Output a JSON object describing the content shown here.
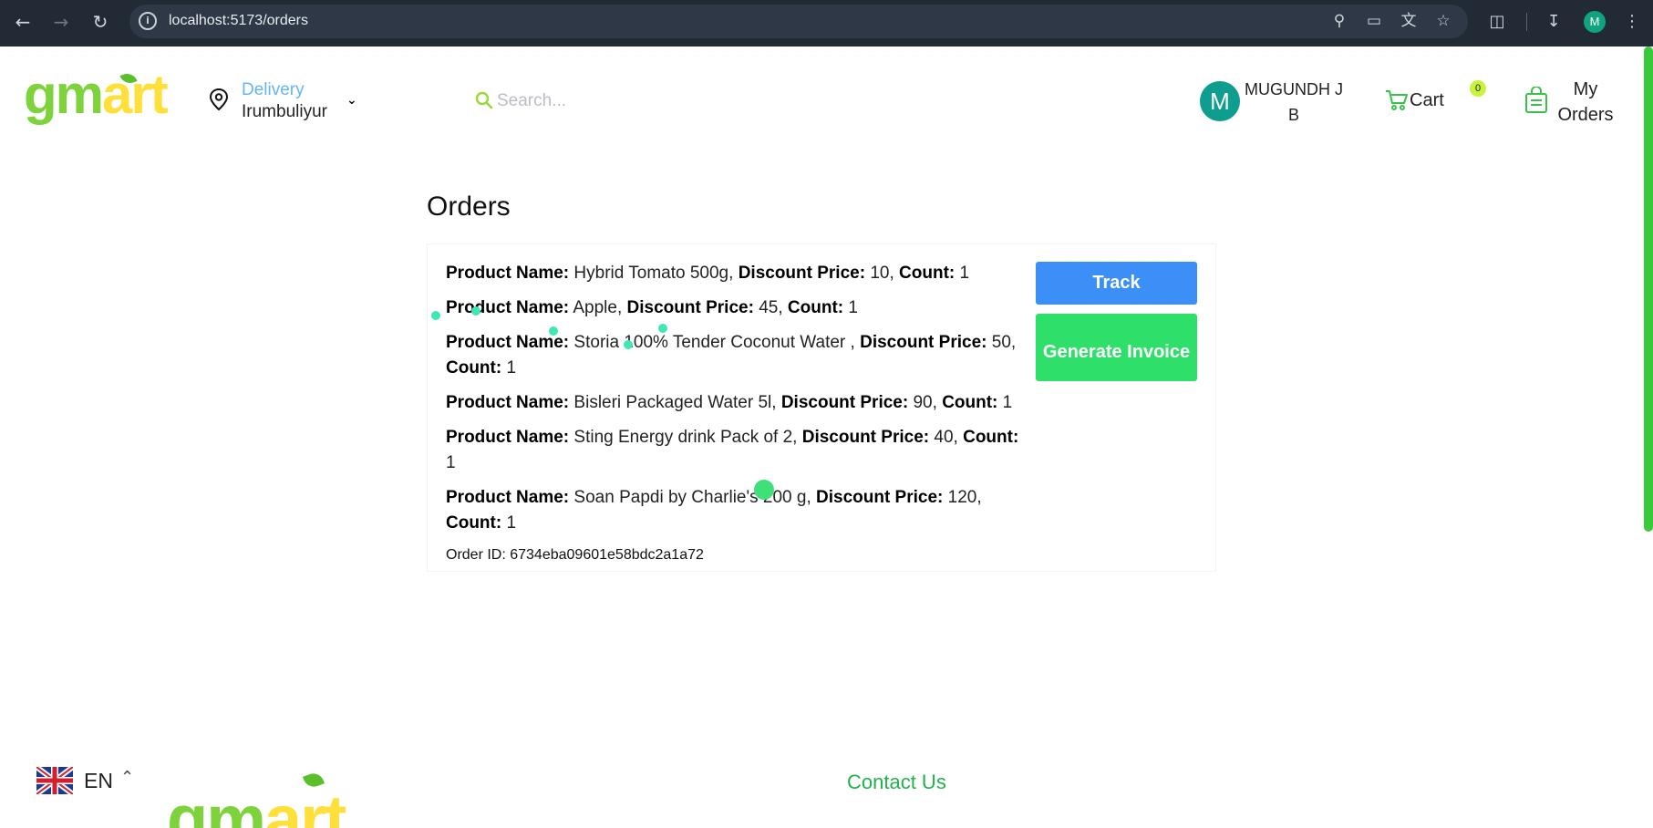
{
  "browser": {
    "url": "localhost:5173/orders",
    "profile_initial": "M"
  },
  "header": {
    "logo": {
      "g": "g",
      "m": "m",
      "a": "a",
      "rt": "rt"
    },
    "delivery_label": "Delivery",
    "city": "Irumbuliyur",
    "search_placeholder": "Search...",
    "user_initial": "M",
    "user_name": "MUGUNDH J B",
    "cart_label": "Cart",
    "cart_count": "0",
    "orders_label": "My Orders"
  },
  "main": {
    "title": "Orders",
    "labels": {
      "product_name": "Product Name:",
      "discount_price": "Discount Price:",
      "count": "Count:"
    },
    "order": {
      "items": [
        {
          "name": "Hybrid Tomato 500g",
          "price": "10",
          "count": "1"
        },
        {
          "name": "Apple",
          "price": "45",
          "count": "1"
        },
        {
          "name": "Storia 100% Tender Coconut Water ",
          "price": "50",
          "count": "1"
        },
        {
          "name": "Bisleri Packaged Water 5l",
          "price": "90",
          "count": "1"
        },
        {
          "name": "Sting Energy drink Pack of 2",
          "price": "40",
          "count": "1"
        },
        {
          "name": "Soan Papdi by Charlie's 200 g",
          "price": "120",
          "count": "1"
        }
      ],
      "order_id": "Order ID: 6734eba09601e58bdc2a1a72"
    },
    "buttons": {
      "track": "Track",
      "invoice": "Generate Invoice"
    }
  },
  "footer": {
    "language": "EN",
    "contact": "Contact Us"
  }
}
